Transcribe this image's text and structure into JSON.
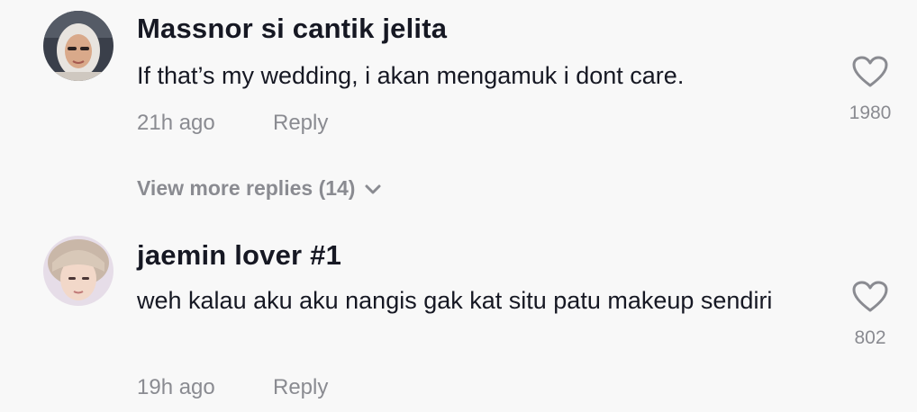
{
  "comments": [
    {
      "username": "Massnor si cantik jelita",
      "text": "If that’s my wedding, i akan mengamuk i dont care.",
      "time": "21h ago",
      "reply_label": "Reply",
      "likes": "1980",
      "view_more": "View more replies (14)"
    },
    {
      "username": "jaemin lover #1",
      "text": "weh kalau aku aku nangis gak kat situ patu makeup sendiri",
      "time": "19h ago",
      "reply_label": "Reply",
      "likes": "802"
    }
  ]
}
